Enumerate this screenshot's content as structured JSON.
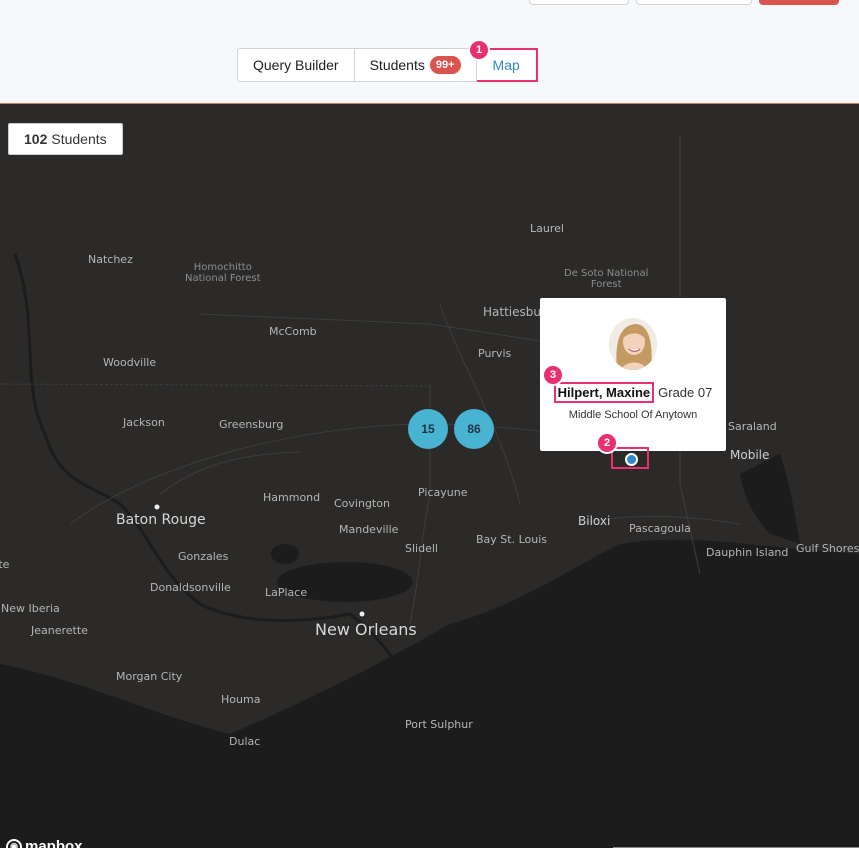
{
  "header": {
    "tabs": [
      {
        "label": "Query Builder",
        "active": false
      },
      {
        "label": "Students",
        "badge": "99+",
        "active": false
      },
      {
        "label": "Map",
        "active": true
      }
    ]
  },
  "annotations": [
    "1",
    "2",
    "3"
  ],
  "map": {
    "student_count": "102",
    "student_count_label": "Students",
    "clusters": [
      "15",
      "86"
    ],
    "places": {
      "natchez": "Natchez",
      "homochitto": "Homochitto",
      "homochitto2": "National Forest",
      "mccomb": "McComb",
      "woodville": "Woodville",
      "laurel": "Laurel",
      "desoto": "De Soto National",
      "desoto2": "Forest",
      "hattiesburg": "Hattiesbur",
      "purvis": "Purvis",
      "jackson": "Jackson",
      "greensburg": "Greensburg",
      "saraland": "Saraland",
      "mobile": "Mobile",
      "hammond": "Hammond",
      "covington": "Covington",
      "picayune": "Picayune",
      "batonrouge": "Baton Rouge",
      "mandeville": "Mandeville",
      "slidell": "Slidell",
      "baystlouis": "Bay St. Louis",
      "biloxi": "Biloxi",
      "pascagoula": "Pascagoula",
      "dauphin": "Dauphin Island",
      "gulfshores": "Gulf Shores",
      "gonzales": "Gonzales",
      "donaldsonville": "Donaldsonville",
      "laplace": "LaPlace",
      "neworleans": "New Orleans",
      "newiberia": "New Iberia",
      "jeanerette": "Jeanerette",
      "morgancity": "Morgan City",
      "houma": "Houma",
      "portsulphur": "Port Sulphur",
      "dulac": "Dulac",
      "te": "tte"
    },
    "popup": {
      "name": "Hilpert, Maxine",
      "grade": "Grade 07",
      "school": "Middle School Of Anytown"
    },
    "logo": "mapbox"
  }
}
